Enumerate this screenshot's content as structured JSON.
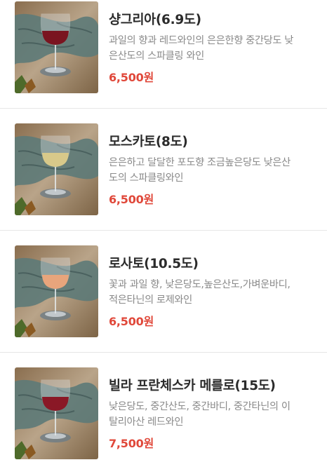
{
  "menu": {
    "items": [
      {
        "name": "샹그리아(6.9도)",
        "desc_lines": [
          "과일의 향과 레드와인의 은은한향 중간당도 낮",
          "은산도의 스파클링 와인"
        ],
        "price": "6,500원",
        "icon": "red-wine-glass-photo",
        "wine_color": "#7a1420"
      },
      {
        "name": "모스카토(8도)",
        "desc_lines": [
          "은은하고 달달한 포도향 조금높은당도 낮은산",
          "도의 스파클링와인"
        ],
        "price": "6,500원",
        "icon": "white-wine-glass-photo",
        "wine_color": "#d8c98a"
      },
      {
        "name": "로사토(10.5도)",
        "desc_lines": [
          "꽃과 과일 향, 낮은당도,높은산도,가벼운바디,",
          "적은타닌의 로제와인"
        ],
        "price": "6,500원",
        "icon": "rose-wine-glass-photo",
        "wine_color": "#e8a57c"
      },
      {
        "name": "빌라 프란체스카 메를로(15도)",
        "desc_lines": [
          "낮은당도, 중간산도, 중간바디, 중간타닌의 이",
          "탈리아산 레드와인"
        ],
        "price": "7,500원",
        "icon": "red-wine-glass-photo",
        "wine_color": "#8a1826"
      }
    ]
  }
}
